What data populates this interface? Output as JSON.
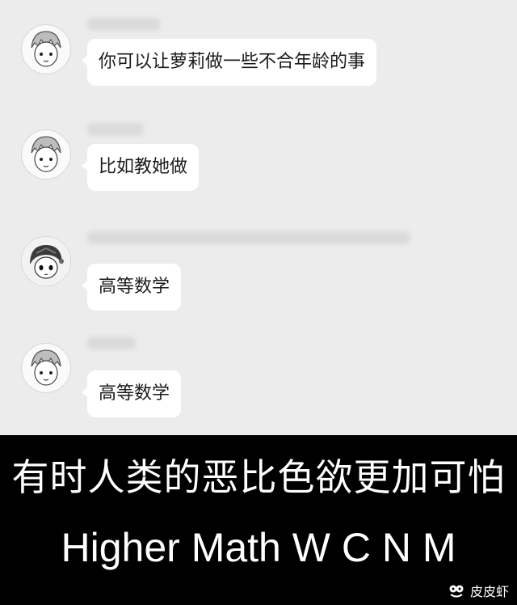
{
  "chat": {
    "messages": [
      {
        "text": "你可以让萝莉做一些不合年龄的事"
      },
      {
        "text": "比如教她做"
      },
      {
        "text": "高等数学"
      },
      {
        "text": "高等数学"
      }
    ]
  },
  "caption": {
    "line1": "有时人类的恶比色欲更加可怕",
    "line2": "Higher Math W C N M"
  },
  "watermark": {
    "icon": "pipixia-logo-icon",
    "text": "皮皮虾"
  }
}
